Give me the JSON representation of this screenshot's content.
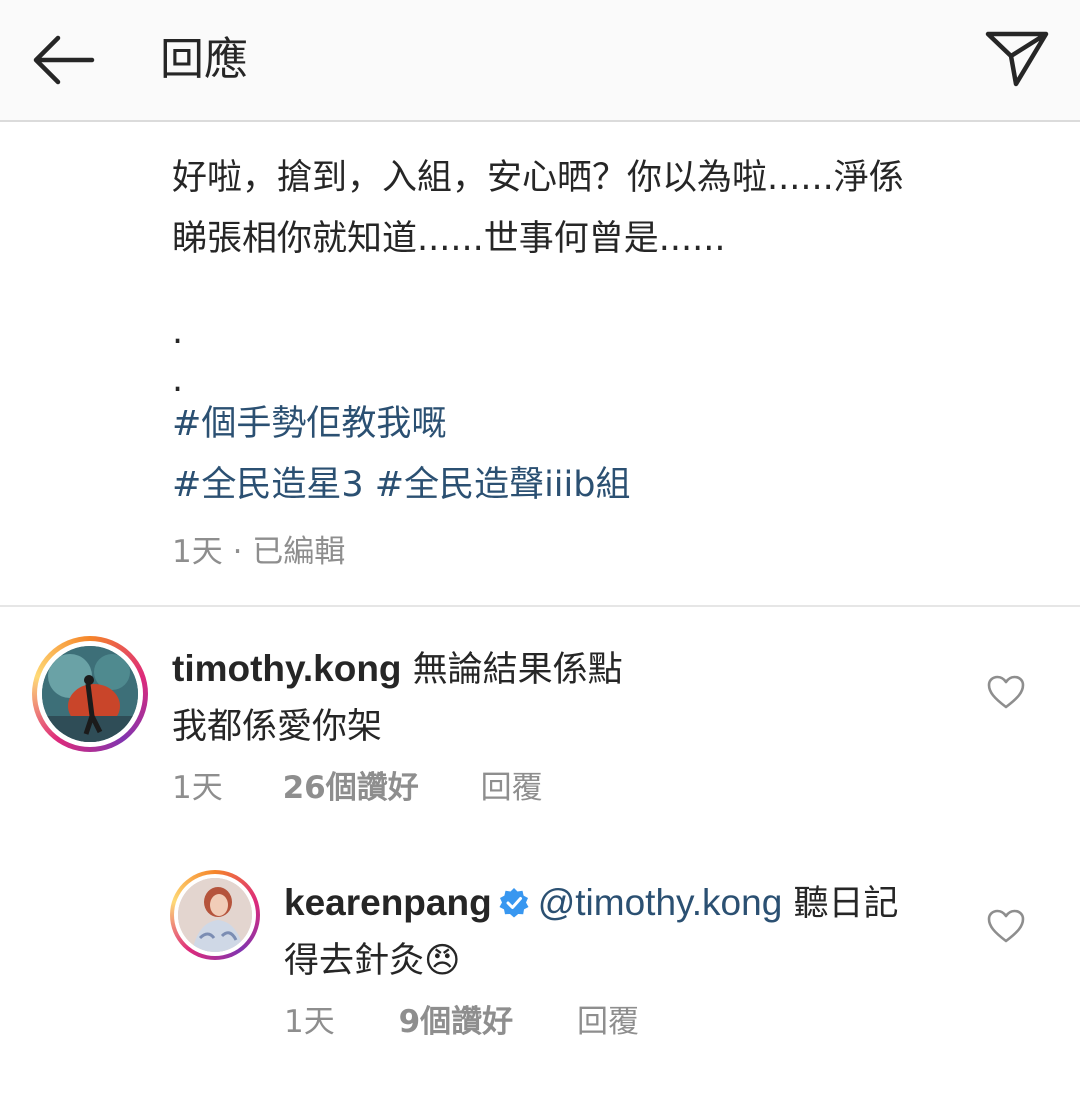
{
  "header": {
    "title": "回應",
    "back_icon": "arrow-left-icon",
    "send_icon": "paper-plane-icon"
  },
  "caption": {
    "lines": [
      "好啦，搶到，入組，安心晒？你以為啦......淨係",
      "睇張相你就知道......世事何曾是......"
    ],
    "dots": [
      ".",
      "."
    ],
    "hashtags": [
      "#個手勢佢教我嘅",
      "#全民造星3",
      "#全民造聲iiib組"
    ],
    "meta": "1天 · 已編輯"
  },
  "comments": [
    {
      "username": "timothy.kong",
      "text_line1": "無論結果係點",
      "text_line2": "我都係愛你架",
      "time": "1天",
      "likes": "26個讚好",
      "reply": "回覆",
      "heart_icon": "heart-outline-icon"
    },
    {
      "username": "kearenpang",
      "verified_icon": "verified-badge-icon",
      "mention": "@timothy.kong",
      "text_line1": "聽日記",
      "text_line2": "得去針灸",
      "emoji": "😠",
      "time": "1天",
      "likes": "9個讚好",
      "reply": "回覆",
      "heart_icon": "heart-outline-icon"
    }
  ],
  "colors": {
    "hashtag": "#2b5072",
    "secondary_text": "#8e8e8e",
    "primary_text": "#262626",
    "verified": "#3897f0"
  }
}
